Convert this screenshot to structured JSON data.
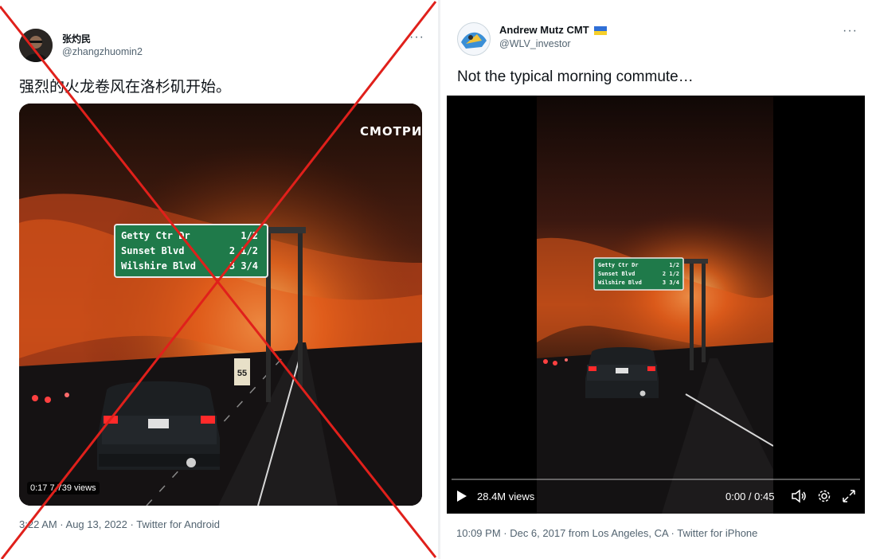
{
  "left_tweet": {
    "display_name": "张灼民",
    "handle": "@zhangzhuomin2",
    "more": "···",
    "text": "强烈的火龙卷风在洛杉矶开始。",
    "watermark": "СМОТРИМ",
    "sign": {
      "line1": "Getty Ctr Dr",
      "line1_dist": "1/2",
      "line2": "Sunset Blvd",
      "line2_dist": "2 1/2",
      "line3": "Wilshire Blvd",
      "line3_dist": "3 3/4"
    },
    "speed_sign": "55",
    "video_badge": "0:17   7,739 views",
    "meta": "3:22 AM · Aug 13, 2022 · Twitter for Android",
    "cross_color": "#e0201b"
  },
  "right_tweet": {
    "display_name": "Andrew Mutz CMT",
    "flag": "ukraine-flag",
    "handle": "@WLV_investor",
    "more": "···",
    "text": "Not the typical morning commute…",
    "sign": {
      "line1": "Getty Ctr Dr",
      "line1_dist": "1/2",
      "line2": "Sunset Blvd",
      "line2_dist": "2 1/2",
      "line3": "Wilshire Blvd",
      "line3_dist": "3 3/4"
    },
    "views": "28.4M views",
    "time": "0:00 / 0:45",
    "progress": 0.0,
    "meta": "10:09 PM · Dec 6, 2017 from Los Angeles, CA · Twitter for iPhone"
  }
}
